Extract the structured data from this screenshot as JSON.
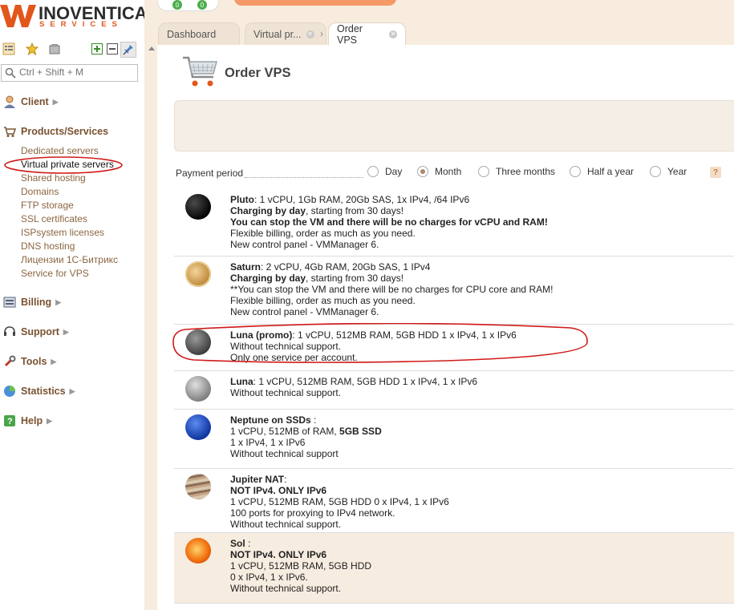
{
  "brand": {
    "name": "INOVENTICA",
    "tagline": "SERVICES"
  },
  "search": {
    "placeholder": "Ctrl + Shift + M"
  },
  "sidebar": {
    "client": "Client",
    "products": "Products/Services",
    "product_items": [
      "Dedicated servers",
      "Virtual private servers",
      "Shared hosting",
      "Domains",
      "FTP storage",
      "SSL certificates",
      "ISPsystem licenses",
      "DNS hosting",
      "Лицензии 1С-Битрикс",
      "Service for VPS"
    ],
    "billing": "Billing",
    "support": "Support",
    "tools": "Tools",
    "statistics": "Statistics",
    "help": "Help"
  },
  "badges": {
    "first": "0",
    "second": "0"
  },
  "tabs": [
    {
      "label": "Dashboard"
    },
    {
      "label": "Virtual pr..."
    },
    {
      "label": "Order VPS"
    }
  ],
  "page": {
    "title": "Order VPS"
  },
  "period": {
    "label": "Payment period",
    "options": [
      "Day",
      "Month",
      "Three months",
      "Half a year",
      "Year"
    ],
    "selected": "Month",
    "help": "?"
  },
  "plans": [
    {
      "name": "Pluto",
      "lines": [
        {
          "text": ": 1 vCPU, 1Gb RAM, 20Gb SAS, 1x IPv4, /64 IPv6"
        },
        {
          "bold": "Charging by day",
          "text": ", starting from 30 days!"
        },
        {
          "bold": "You can stop the VM and there will be no charges for vCPU and RAM!"
        },
        {
          "text": "Flexible billing, order as much as you need."
        },
        {
          "text": "New control panel - VMManager 6."
        }
      ]
    },
    {
      "name": "Saturn",
      "lines": [
        {
          "text": ": 2 vCPU, 4Gb RAM, 20Gb SAS, 1 IPv4"
        },
        {
          "bold": "Charging by day",
          "text": ", starting from 30 days!"
        },
        {
          "text": "**You can stop the VM and there will be no charges for CPU core and RAM!"
        },
        {
          "text": "Flexible billing, order as much as you need."
        },
        {
          "text": "New control panel - VMManager 6."
        }
      ]
    },
    {
      "name": "Luna (promo)",
      "lines": [
        {
          "text": ": 1 vCPU, 512MB RAM, 5GB HDD 1 x IPv4, 1 x IPv6"
        },
        {
          "text": "Without technical support."
        },
        {
          "text": "Only one service per account."
        }
      ]
    },
    {
      "name": "Luna",
      "lines": [
        {
          "text": ": 1 vCPU, 512MB RAM, 5GB HDD 1 x IPv4, 1 x IPv6"
        },
        {
          "text": "Without technical support."
        }
      ]
    },
    {
      "name": "Neptune on SSDs",
      "lines": [
        {
          "text": " :"
        },
        {
          "text": "1 vCPU, 512MB of RAM, ",
          "bold2": "5GB SSD"
        },
        {
          "text": "1 x IPv4, 1 x IPv6"
        },
        {
          "text": "Without technical support"
        }
      ]
    },
    {
      "name": "Jupiter NAT",
      "lines": [
        {
          "text": ":"
        },
        {
          "bold": "NOT IPv4. ONLY IPv6"
        },
        {
          "text": "1 vCPU, 512MB RAM, 5GB HDD 0 x IPv4, 1 x IPv6"
        },
        {
          "text": "100 ports for proxying to IPv4 network."
        },
        {
          "text": "Without technical support."
        }
      ]
    },
    {
      "name": "Sol",
      "lines": [
        {
          "text": " :"
        },
        {
          "bold": "NOT IPv4. ONLY IPv6"
        },
        {
          "text": "1 vCPU, 512MB RAM, 5GB HDD"
        },
        {
          "text": "0 x IPv4, 1 x IPv6."
        },
        {
          "text": "Without technical support."
        }
      ]
    }
  ],
  "colors": {
    "accent": "#e2561c",
    "menu": "#7a5230",
    "link": "#8a6640",
    "annotation": "#d11a1a",
    "panel": "#f7ecde"
  }
}
